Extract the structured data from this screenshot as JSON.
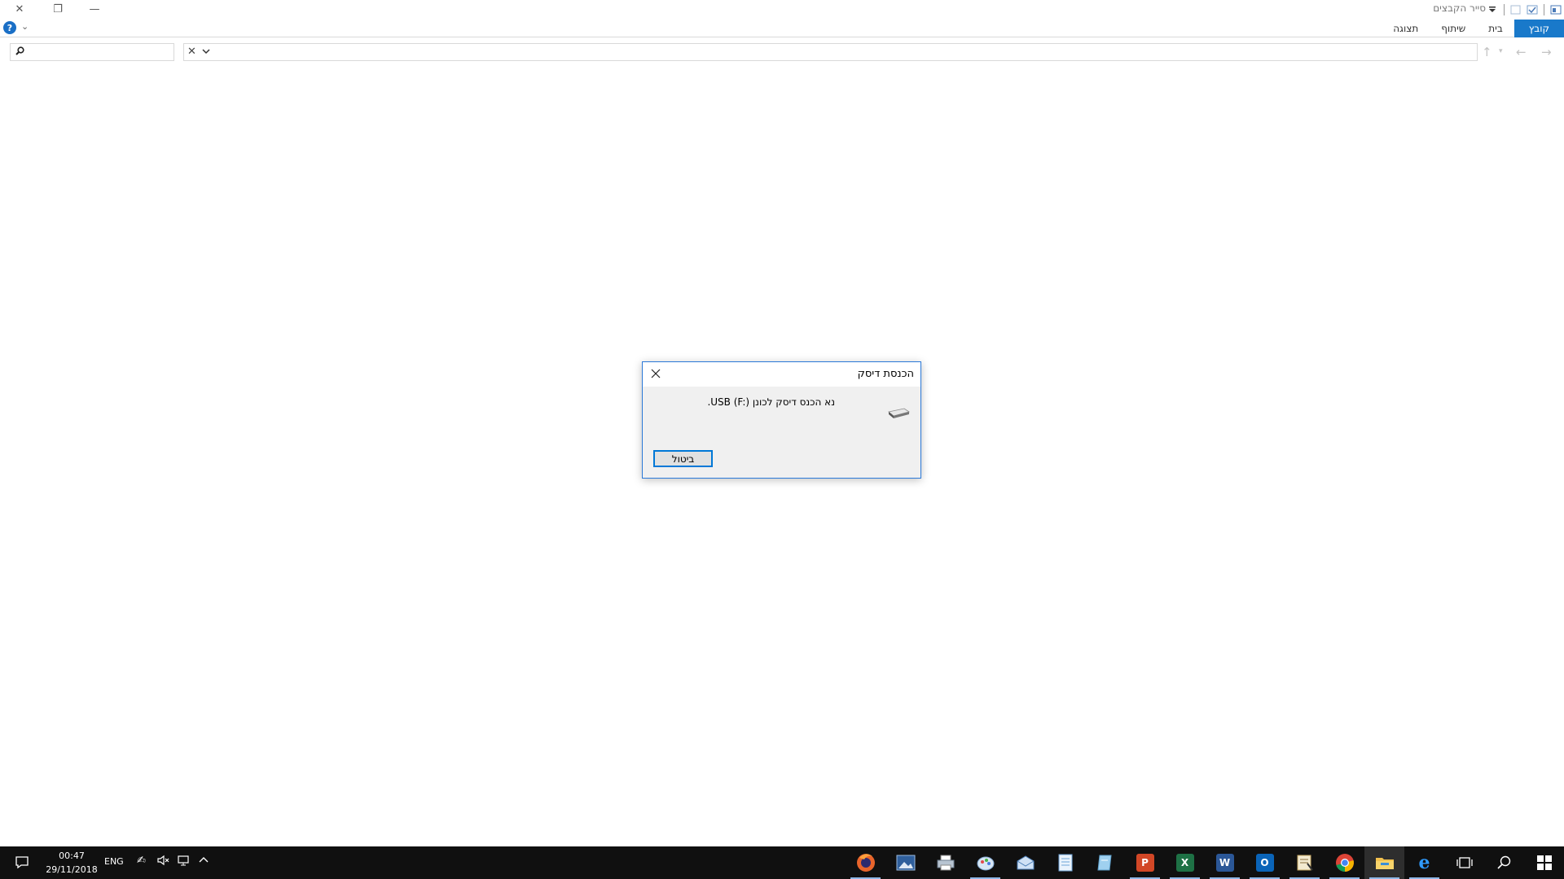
{
  "window": {
    "title": "סייר הקבצים",
    "controls": {
      "close": "✕",
      "maximize": "❐",
      "minimize": "—"
    }
  },
  "ribbon": {
    "tabs": [
      {
        "id": "file",
        "label": "קובץ"
      },
      {
        "id": "home",
        "label": "בית"
      },
      {
        "id": "share",
        "label": "שיתוף"
      },
      {
        "id": "view",
        "label": "תצוגה"
      }
    ],
    "help_icon": "?",
    "expand_icon": "⌄"
  },
  "navigation": {
    "search": {
      "value": "",
      "placeholder": ""
    },
    "address": {
      "value": ""
    }
  },
  "dialog": {
    "title": "הכנסת דיסק",
    "message": "נא הכנס דיסק לכונן USB (F:).",
    "cancel_label": "ביטול"
  },
  "taskbar": {
    "time": "00:47",
    "date": "29/11/2018",
    "language": "ENG",
    "apps": [
      {
        "name": "start-icon",
        "glyph": "⊞",
        "color": "#101010"
      },
      {
        "name": "search-icon",
        "glyph": "⌕",
        "color": "#101010"
      },
      {
        "name": "task-view-icon",
        "glyph": "▭",
        "color": "#101010"
      },
      {
        "name": "internet-explorer-icon",
        "glyph": "e",
        "color": "#1e90ff"
      },
      {
        "name": "file-explorer-icon",
        "glyph": "▬",
        "color": "#f0c043"
      },
      {
        "name": "chrome-icon",
        "glyph": "●",
        "color": "#e04a3b"
      },
      {
        "name": "certificate-icon",
        "glyph": "✎",
        "color": "#c8a24e"
      },
      {
        "name": "outlook-icon",
        "glyph": "O",
        "color": "#0a64b8"
      },
      {
        "name": "word-icon",
        "glyph": "W",
        "color": "#2b5797"
      },
      {
        "name": "excel-icon",
        "glyph": "X",
        "color": "#1e7145"
      },
      {
        "name": "powerpoint-icon",
        "glyph": "P",
        "color": "#d24726"
      },
      {
        "name": "writer-icon",
        "glyph": "✐",
        "color": "#5fa8d3"
      },
      {
        "name": "notepad-icon",
        "glyph": "▤",
        "color": "#6fa5d8"
      },
      {
        "name": "mail-icon",
        "glyph": "✉",
        "color": "#4d7fb8"
      },
      {
        "name": "paint-icon",
        "glyph": "◐",
        "color": "#8fb3d9"
      },
      {
        "name": "printer-icon",
        "glyph": "▣",
        "color": "#7a8fa8"
      },
      {
        "name": "photo-icon",
        "glyph": "▦",
        "color": "#4a7bb5"
      },
      {
        "name": "firefox-icon",
        "glyph": "◉",
        "color": "#e86a2b"
      }
    ]
  }
}
